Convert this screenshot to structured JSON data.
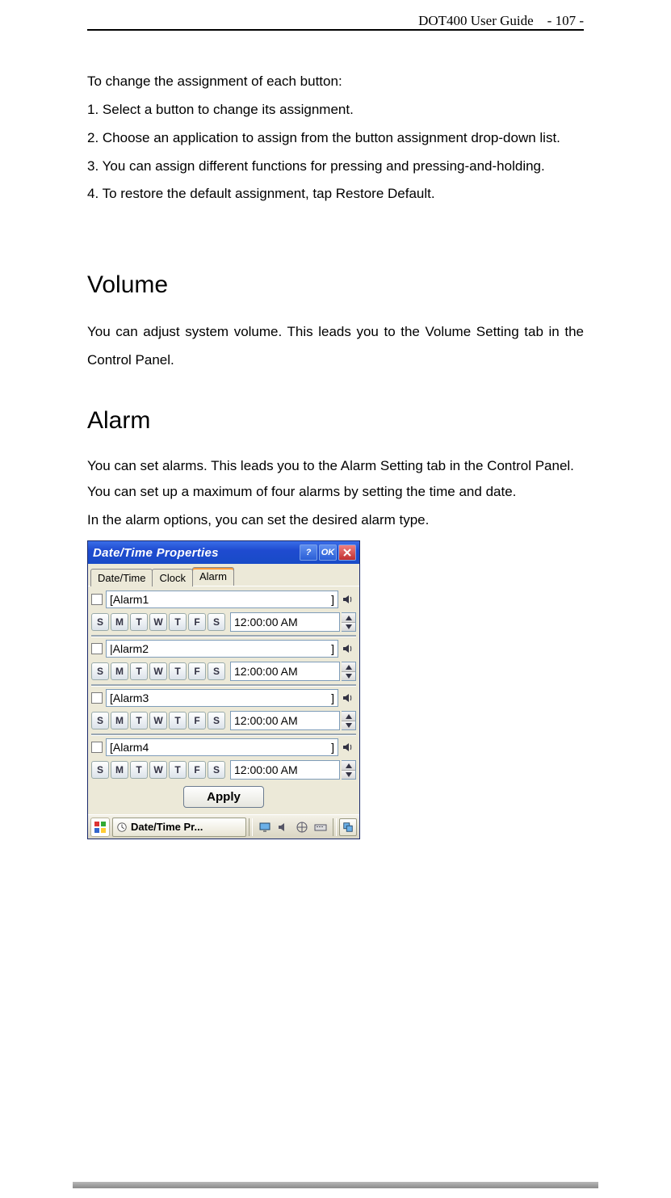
{
  "header": {
    "doc": "DOT400 User Guide",
    "page": "- 107 -"
  },
  "intro": {
    "lead": "To change the assignment of each button:",
    "s1": "1. Select a button to change its assignment.",
    "s2": "2. Choose an application to assign from the button assignment drop-down list.",
    "s3": "3. You can assign different functions for pressing and pressing-and-holding.",
    "s4": "4. To restore the default assignment, tap Restore Default."
  },
  "volume": {
    "heading": "Volume",
    "text": "You can adjust system volume. This leads you to the Volume Setting tab in the Control Panel."
  },
  "alarm": {
    "heading": "Alarm",
    "p1": "You can set alarms. This leads you to the Alarm Setting tab in the Control Panel.",
    "p2": "You can set up a maximum of four alarms by setting the time and date.",
    "p3": "In the alarm options, you can set the desired alarm type."
  },
  "dialog": {
    "title": "Date/Time Properties",
    "tabs": {
      "t1": "Date/Time",
      "t2": "Clock",
      "t3": "Alarm"
    },
    "days": [
      "S",
      "M",
      "T",
      "W",
      "T",
      "F",
      "S"
    ],
    "alarms": [
      {
        "name": "[Alarm1",
        "time": "12:00:00 AM"
      },
      {
        "name": "|Alarm2",
        "time": "12:00:00 AM"
      },
      {
        "name": "[Alarm3",
        "time": "12:00:00 AM"
      },
      {
        "name": "[Alarm4",
        "time": "12:00:00 AM"
      }
    ],
    "apply": "Apply",
    "task": "Date/Time Pr..."
  }
}
